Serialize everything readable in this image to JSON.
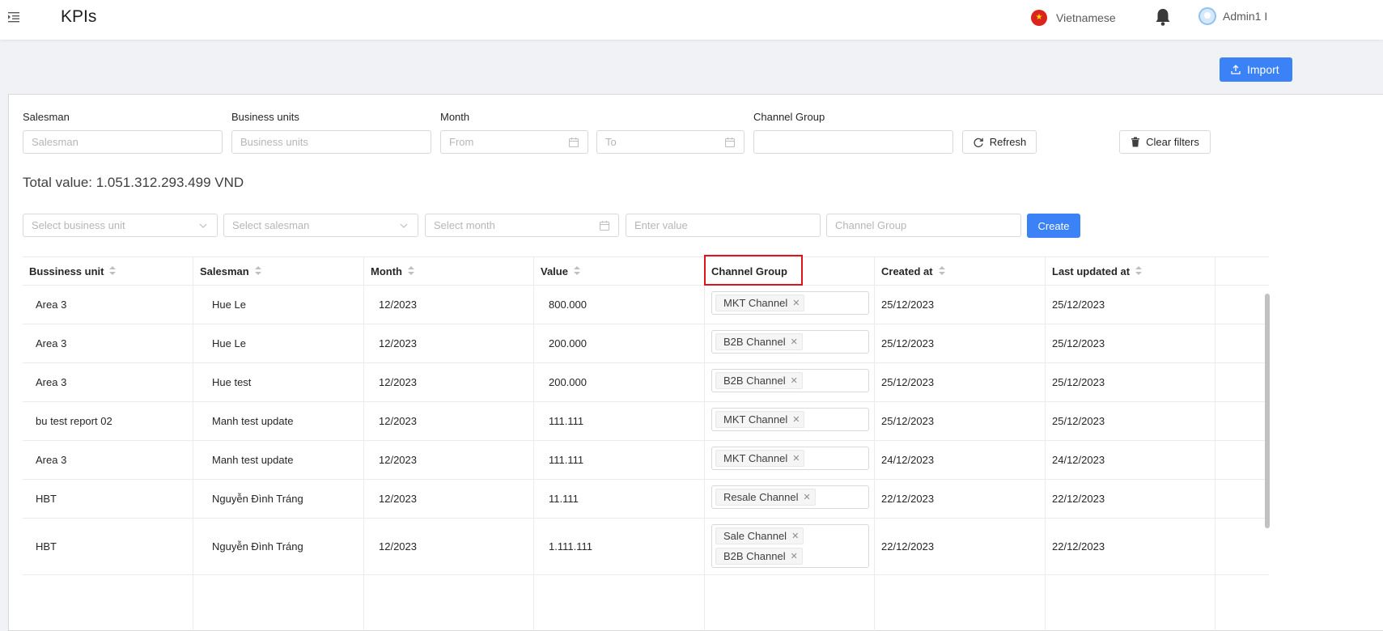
{
  "header": {
    "title": "KPIs",
    "language": "Vietnamese",
    "user_name": "Admin1 I"
  },
  "import_button": "Import",
  "filters": {
    "salesman": {
      "label": "Salesman",
      "placeholder": "Salesman"
    },
    "business_units": {
      "label": "Business units",
      "placeholder": "Business units"
    },
    "month": {
      "label": "Month",
      "from_placeholder": "From",
      "to_placeholder": "To"
    },
    "channel_group": {
      "label": "Channel Group",
      "value": ""
    },
    "refresh": "Refresh",
    "clear": "Clear filters"
  },
  "total": "Total value: 1.051.312.293.499 VND",
  "create_form": {
    "business_unit_placeholder": "Select business unit",
    "salesman_placeholder": "Select salesman",
    "month_placeholder": "Select month",
    "value_placeholder": "Enter value",
    "channel_placeholder": "Channel Group",
    "create": "Create"
  },
  "table": {
    "headers": [
      "Bussiness unit",
      "Salesman",
      "Month",
      "Value",
      "Channel Group",
      "Created at",
      "Last updated at"
    ],
    "rows": [
      {
        "bu": "Area 3",
        "salesman": "Hue Le",
        "month": "12/2023",
        "value": "800.000",
        "channels": [
          "MKT Channel"
        ],
        "created": "25/12/2023",
        "updated": "25/12/2023"
      },
      {
        "bu": "Area 3",
        "salesman": "Hue Le",
        "month": "12/2023",
        "value": "200.000",
        "channels": [
          "B2B Channel"
        ],
        "created": "25/12/2023",
        "updated": "25/12/2023"
      },
      {
        "bu": "Area 3",
        "salesman": "Hue test",
        "month": "12/2023",
        "value": "200.000",
        "channels": [
          "B2B Channel"
        ],
        "created": "25/12/2023",
        "updated": "25/12/2023"
      },
      {
        "bu": "bu test report 02",
        "salesman": "Manh test update",
        "month": "12/2023",
        "value": "111.111",
        "channels": [
          "MKT Channel"
        ],
        "created": "25/12/2023",
        "updated": "25/12/2023"
      },
      {
        "bu": "Area 3",
        "salesman": "Manh test update",
        "month": "12/2023",
        "value": "111.111",
        "channels": [
          "MKT Channel"
        ],
        "created": "24/12/2023",
        "updated": "24/12/2023"
      },
      {
        "bu": "HBT",
        "salesman": "Nguyễn Đình Tráng",
        "month": "12/2023",
        "value": "11.111",
        "channels": [
          "Resale Channel"
        ],
        "created": "22/12/2023",
        "updated": "22/12/2023"
      },
      {
        "bu": "HBT",
        "salesman": "Nguyễn Đình Tráng",
        "month": "12/2023",
        "value": "1.111.111",
        "channels": [
          "Sale Channel",
          "B2B Channel"
        ],
        "created": "22/12/2023",
        "updated": "22/12/2023"
      }
    ]
  }
}
